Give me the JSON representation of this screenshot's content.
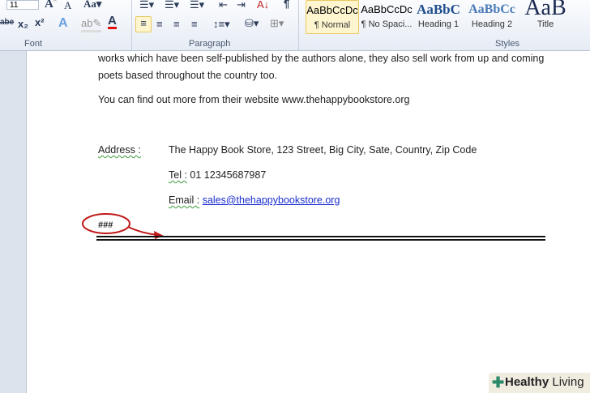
{
  "ribbon": {
    "font_size": "11",
    "groups": {
      "font": "Font",
      "paragraph": "Paragraph",
      "styles": "Styles"
    },
    "styles": [
      {
        "preview": "AaBbCcDc",
        "name": "¶ Normal",
        "selected": true
      },
      {
        "preview": "AaBbCcDc",
        "name": "¶ No Spaci...",
        "selected": false
      },
      {
        "preview": "AaBbC",
        "name": "Heading 1",
        "selected": false
      },
      {
        "preview": "AaBbCc",
        "name": "Heading 2",
        "selected": false
      },
      {
        "preview": "AaB",
        "name": "Title",
        "selected": false
      }
    ]
  },
  "document": {
    "line1": "works which have been self-published by the authors alone, they also sell work from up and coming",
    "line2": "poets based throughout the country too.",
    "line3": "You can find out more from their website www.thehappybookstore.org",
    "address_label": "Address :",
    "address_value": "The Happy Book Store, 123  Street, Big City, Sate, Country, Zip Code",
    "tel_label": "Tel :",
    "tel_value": "01  12345687987",
    "email_label": "Email :",
    "email_value": "sales@thehappybookstore.org",
    "end_mark": "###"
  },
  "watermark": {
    "bold": "Healthy",
    "rest": " Living"
  }
}
